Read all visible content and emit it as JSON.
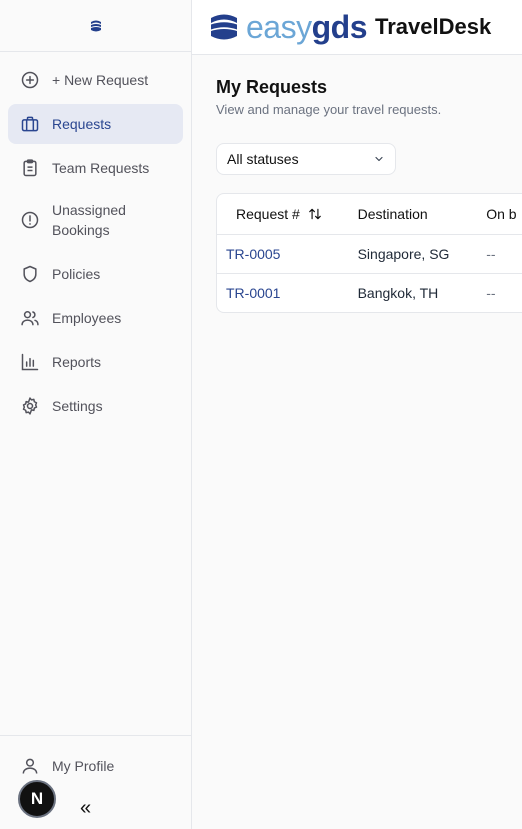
{
  "sidebar": {
    "items": [
      {
        "label": "+ New Request",
        "icon": "plus-circle-icon"
      },
      {
        "label": "Requests",
        "icon": "briefcase-icon",
        "active": true
      },
      {
        "label": "Team Requests",
        "icon": "clipboard-icon"
      },
      {
        "label": "Unassigned Bookings",
        "icon": "alert-circle-icon"
      },
      {
        "label": "Policies",
        "icon": "shield-icon"
      },
      {
        "label": "Employees",
        "icon": "users-icon"
      },
      {
        "label": "Reports",
        "icon": "bar-chart-icon"
      },
      {
        "label": "Settings",
        "icon": "gear-icon"
      }
    ],
    "profile_label": "My Profile",
    "badge_letter": "N",
    "collapse_glyph": "«"
  },
  "header": {
    "brand_easy": "easy",
    "brand_gds": "gds",
    "brand_product": "TravelDesk"
  },
  "main": {
    "title": "My Requests",
    "subtitle": "View and manage your travel requests.",
    "filter": {
      "selected": "All statuses"
    },
    "table": {
      "columns": [
        "Request #",
        "Destination",
        "On b"
      ],
      "rows": [
        {
          "request": "TR-0005",
          "destination": "Singapore, SG",
          "onb": "--"
        },
        {
          "request": "TR-0001",
          "destination": "Bangkok, TH",
          "onb": "--"
        }
      ]
    }
  },
  "colors": {
    "accent": "#2a4690",
    "active_bg": "#e6e9f3",
    "brand_light": "#6ba6d6",
    "brand_dark": "#233f8c"
  }
}
